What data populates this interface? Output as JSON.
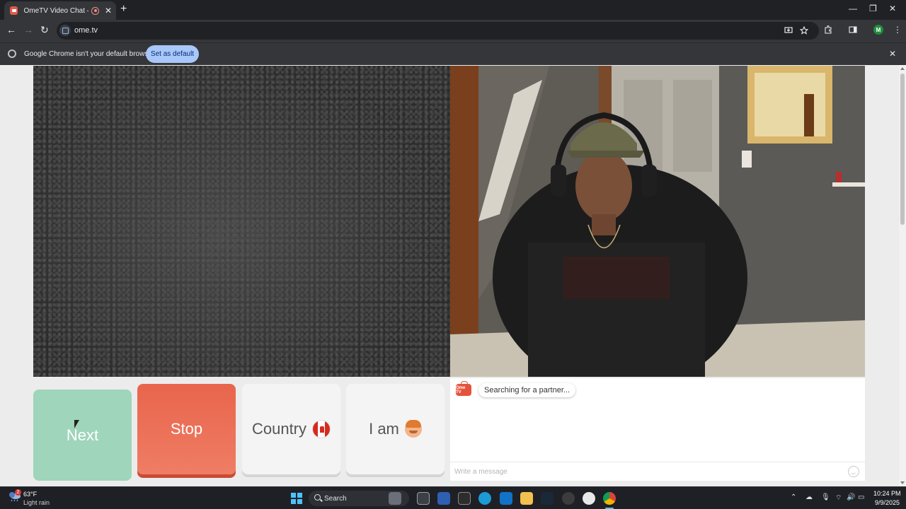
{
  "browser": {
    "tab": {
      "title": "OmeTV Video Chat — Ome",
      "close": "✕"
    },
    "new_tab": "+",
    "window_controls": {
      "minimize": "—",
      "maximize": "❐",
      "close": "✕"
    },
    "nav": {
      "back": "←",
      "forward": "→",
      "reload": "↻"
    },
    "url": "ome.tv",
    "toolbar_icons": [
      "install-icon",
      "star-icon",
      "extensions-icon",
      "sidepanel-icon",
      "menu-icon"
    ],
    "profile_initial": "M",
    "menu_glyph": "⋮"
  },
  "infobar": {
    "message": "Google Chrome isn't your default browser",
    "button": "Set as default",
    "close": "✕"
  },
  "controls": {
    "next_label": "Next",
    "stop_label": "Stop",
    "country_label": "Country",
    "iam_label": "I am"
  },
  "chat": {
    "logo_text": "Ome TV",
    "status": "Searching for a partner...",
    "message_placeholder": "Write a message"
  },
  "taskbar": {
    "weather_temp": "63°F",
    "weather_desc": "Light rain",
    "weather_badge": "2",
    "search_label": "Search",
    "time": "10:24 PM",
    "date": "9/9/2025"
  },
  "colors": {
    "next_button": "#9fd5ba",
    "stop_button": "#e8654c",
    "accent": "#a8c7fa",
    "brand": "#e5533d"
  }
}
